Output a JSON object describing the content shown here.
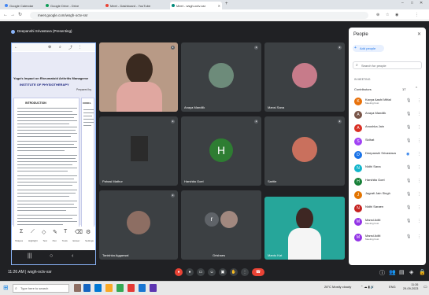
{
  "browser": {
    "tabs": [
      {
        "title": "Google Calendar",
        "color": "#4285f4"
      },
      {
        "title": "Google Drive - Drive",
        "color": "#0f9d58"
      },
      {
        "title": "Meet - Dashboard - YouTube",
        "color": "#ea4335"
      },
      {
        "title": "Meet - wsgh-octv-ssr",
        "color": "#00897b"
      }
    ],
    "url": "meet.google.com/wsgh-octv-ssr"
  },
  "meeting": {
    "presenting_label": "Deepanshi Srivastava (Presenting)",
    "clock": "11:26 AM",
    "meeting_code": "wsgh-octv-ssr",
    "tiles": [
      {
        "name": "",
        "kind": "video"
      },
      {
        "name": "Anaya Mandlik",
        "kind": "avatar"
      },
      {
        "name": "Mansi Sana",
        "kind": "avatar"
      },
      {
        "name": "Pahasi Mathur",
        "kind": "video"
      },
      {
        "name": "Harshita Goel",
        "kind": "letter",
        "letter": "H"
      },
      {
        "name": "Saritle",
        "kind": "avatar"
      },
      {
        "name": "Tanishka Aggarwal",
        "kind": "avatar"
      },
      {
        "name": "Grishaes",
        "kind": "avatar",
        "letter": "r"
      },
      {
        "name": "Mantu Kat",
        "kind": "video"
      }
    ],
    "controls": [
      {
        "icon": "mic-off-icon",
        "glyph": "●",
        "color": "#ea4335"
      },
      {
        "icon": "camera-icon",
        "glyph": "●",
        "color": "#3c4043"
      },
      {
        "icon": "captions-icon",
        "glyph": "▭",
        "color": "#3c4043"
      },
      {
        "icon": "emoji-icon",
        "glyph": "☺",
        "color": "#3c4043"
      },
      {
        "icon": "present-icon",
        "glyph": "▣",
        "color": "#3c4043"
      },
      {
        "icon": "raise-hand-icon",
        "glyph": "✋",
        "color": "#3c4043"
      },
      {
        "icon": "more-options-icon",
        "glyph": "⋮",
        "color": "#3c4043"
      },
      {
        "icon": "leave-call-icon",
        "glyph": "☎",
        "color": "#ea4335"
      }
    ]
  },
  "shared_doc": {
    "title_line": "Yoga's Impact on Rheumatoid Arthritis Manageme",
    "institute": "INSTITUTE OF PHYSIOTHERAPY",
    "preparer": "Prepared by",
    "section_intro": "INTRODUCTION",
    "section_concl": "CONCL",
    "toolbar_labels": [
      "Shapes",
      "Highlight",
      "Text",
      "Pen",
      "Tools",
      "Eraser",
      "Settings"
    ]
  },
  "people_panel": {
    "title": "People",
    "add_people": "Add people",
    "search_placeholder": "Search for people",
    "in_meeting": "IN MEETING",
    "contributors_label": "Contributors",
    "contributors_count": "17",
    "people": [
      {
        "name": "Kavya Aashi Mittal",
        "sub": "Meeting host",
        "color": "#e8710a",
        "letter": "K"
      },
      {
        "name": "Anaya Mandlik",
        "sub": "",
        "color": "#795548",
        "letter": "A"
      },
      {
        "name": "Anushka Jain",
        "sub": "",
        "color": "#d93025",
        "letter": "A"
      },
      {
        "name": "Sidhat",
        "sub": "",
        "color": "#a142f4",
        "letter": "S"
      },
      {
        "name": "Deepanshi Srivastava",
        "sub": "",
        "color": "#1a73e8",
        "letter": "D"
      },
      {
        "name": "Nidhi Sana",
        "sub": "",
        "color": "#12b5cb",
        "letter": "N"
      },
      {
        "name": "Harshita Goel",
        "sub": "",
        "color": "#188038",
        "letter": "H"
      },
      {
        "name": "Jagrati Jain Singh",
        "sub": "",
        "color": "#e37400",
        "letter": "J"
      },
      {
        "name": "Nidhi Saraen",
        "sub": "",
        "color": "#c5221f",
        "letter": "N"
      },
      {
        "name": "Mansi Aditi",
        "sub": "Meeting host",
        "color": "#9334e6",
        "letter": "M"
      },
      {
        "name": "Mansi Aditi",
        "sub": "Meeting host",
        "color": "#9334e6",
        "letter": "M"
      }
    ]
  },
  "taskbar": {
    "search_placeholder": "Type here to search",
    "weather": "28°C Mostly cloudy",
    "time": "11:26",
    "date": "29-09-2023",
    "lang": "ENG"
  }
}
